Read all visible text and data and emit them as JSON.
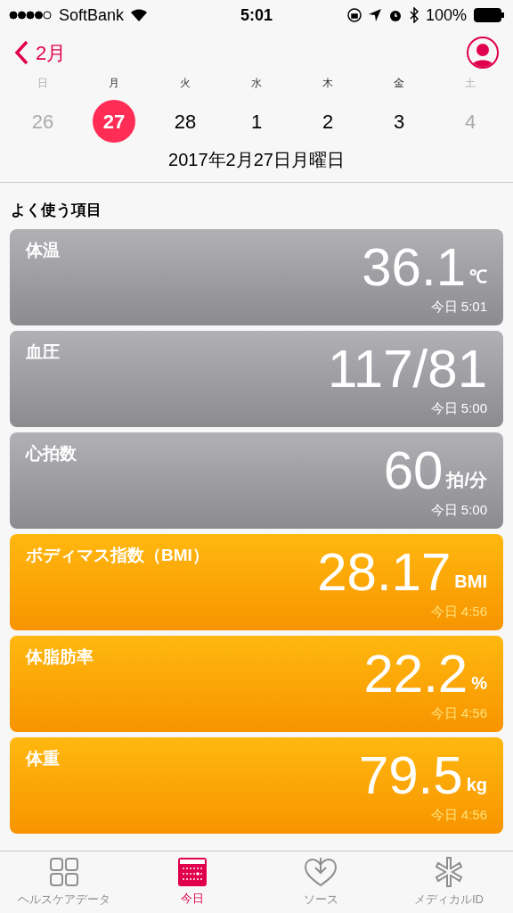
{
  "status_bar": {
    "carrier": "SoftBank",
    "time": "5:01",
    "battery": "100%"
  },
  "nav": {
    "back_label": "2月"
  },
  "week": [
    {
      "weekday": "日",
      "day": "26",
      "selected": false,
      "dimmed": true
    },
    {
      "weekday": "月",
      "day": "27",
      "selected": true,
      "dimmed": false
    },
    {
      "weekday": "火",
      "day": "28",
      "selected": false,
      "dimmed": false
    },
    {
      "weekday": "水",
      "day": "1",
      "selected": false,
      "dimmed": false
    },
    {
      "weekday": "木",
      "day": "2",
      "selected": false,
      "dimmed": false
    },
    {
      "weekday": "金",
      "day": "3",
      "selected": false,
      "dimmed": false
    },
    {
      "weekday": "土",
      "day": "4",
      "selected": false,
      "dimmed": true
    }
  ],
  "date_label": "2017年2月27日月曜日",
  "section_title": "よく使う項目",
  "cards": [
    {
      "kind": "vitals",
      "title": "体温",
      "value": "36.1",
      "unit": "℃",
      "time": "今日 5:01"
    },
    {
      "kind": "vitals",
      "title": "血圧",
      "value": "117/81",
      "time": "今日 5:00"
    },
    {
      "kind": "vitals",
      "title": "心拍数",
      "value": "60",
      "unit": "拍/分",
      "time": "今日 5:00"
    },
    {
      "kind": "body",
      "title": "ボディマス指数（BMI）",
      "value": "28.17",
      "unit": "BMI",
      "time": "今日 4:56"
    },
    {
      "kind": "body",
      "title": "体脂肪率",
      "value": "22.2",
      "unit": "%",
      "time": "今日 4:56"
    },
    {
      "kind": "body",
      "title": "体重",
      "value": "79.5",
      "unit": "kg",
      "time": "今日 4:56"
    }
  ],
  "tab_bar": [
    {
      "kind": "grid",
      "label": "ヘルスケアデータ",
      "selected": false
    },
    {
      "kind": "calendar",
      "label": "今日",
      "selected": true
    },
    {
      "kind": "heart",
      "label": "ソース",
      "selected": false
    },
    {
      "kind": "asterisk",
      "label": "メディカルID",
      "selected": false
    }
  ]
}
